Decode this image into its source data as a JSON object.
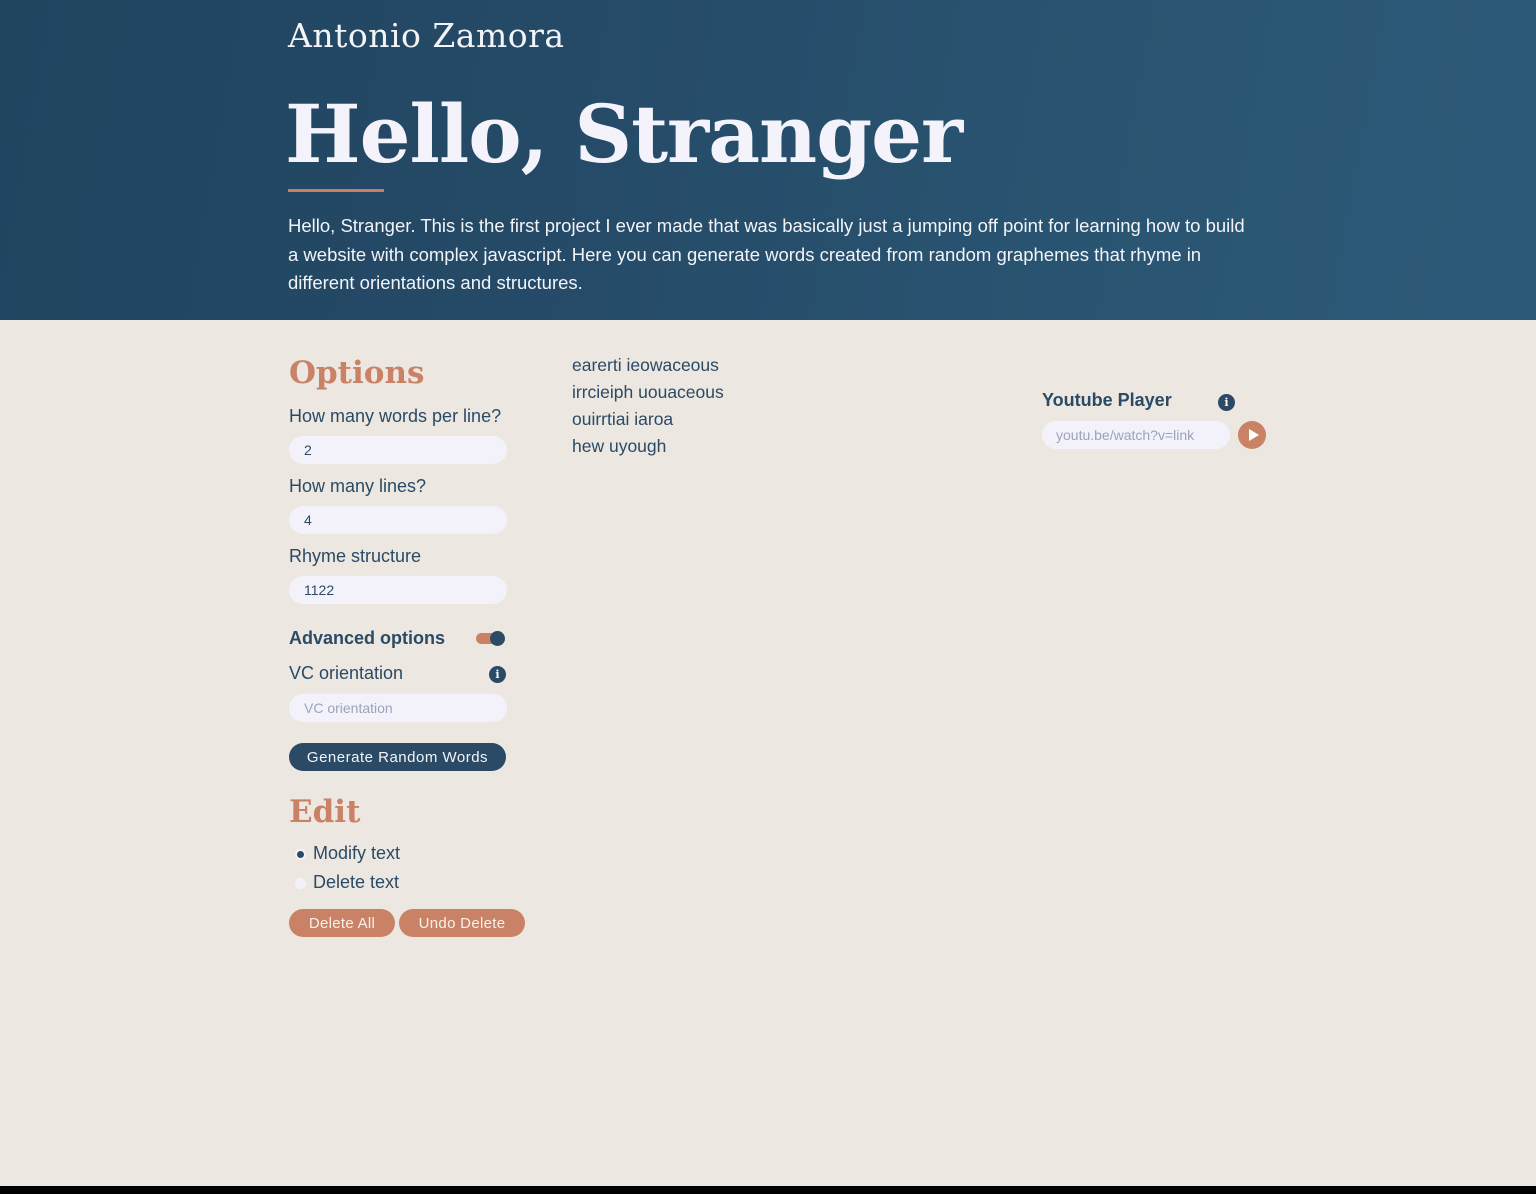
{
  "hero": {
    "author": "Antonio Zamora",
    "title": "Hello, Stranger",
    "intro": "Hello, Stranger. This is the first project I ever made that was basically just a jumping off point for learning how to build a website with complex javascript. Here you can generate words created from random graphemes that rhyme in different orientations and structures."
  },
  "options": {
    "heading": "Options",
    "words_per_line_label": "How many words per line?",
    "words_per_line_value": "2",
    "lines_label": "How many lines?",
    "lines_value": "4",
    "rhyme_label": "Rhyme structure",
    "rhyme_value": "1122",
    "advanced_label": "Advanced options",
    "advanced_enabled": true,
    "vc_label": "VC orientation",
    "vc_placeholder": "VC orientation",
    "info_icon": "i",
    "generate_label": "Generate Random Words"
  },
  "edit": {
    "heading": "Edit",
    "modes": [
      {
        "label": "Modify text",
        "selected": true
      },
      {
        "label": "Delete text",
        "selected": false
      }
    ],
    "delete_all_label": "Delete All",
    "undo_delete_label": "Undo Delete"
  },
  "results": {
    "lines": [
      "earerti ieowaceous",
      "irrcieiph uouaceous",
      "ouirrtiai iaroa",
      "hew uyough"
    ]
  },
  "youtube": {
    "title": "Youtube Player",
    "placeholder": "youtu.be/watch?v=link",
    "info_icon": "i",
    "play_icon": "play-icon"
  },
  "colors": {
    "navy": "#2a4a66",
    "accent": "#c98266",
    "background": "#ece7e0",
    "input_bg": "#f3f2fb"
  }
}
